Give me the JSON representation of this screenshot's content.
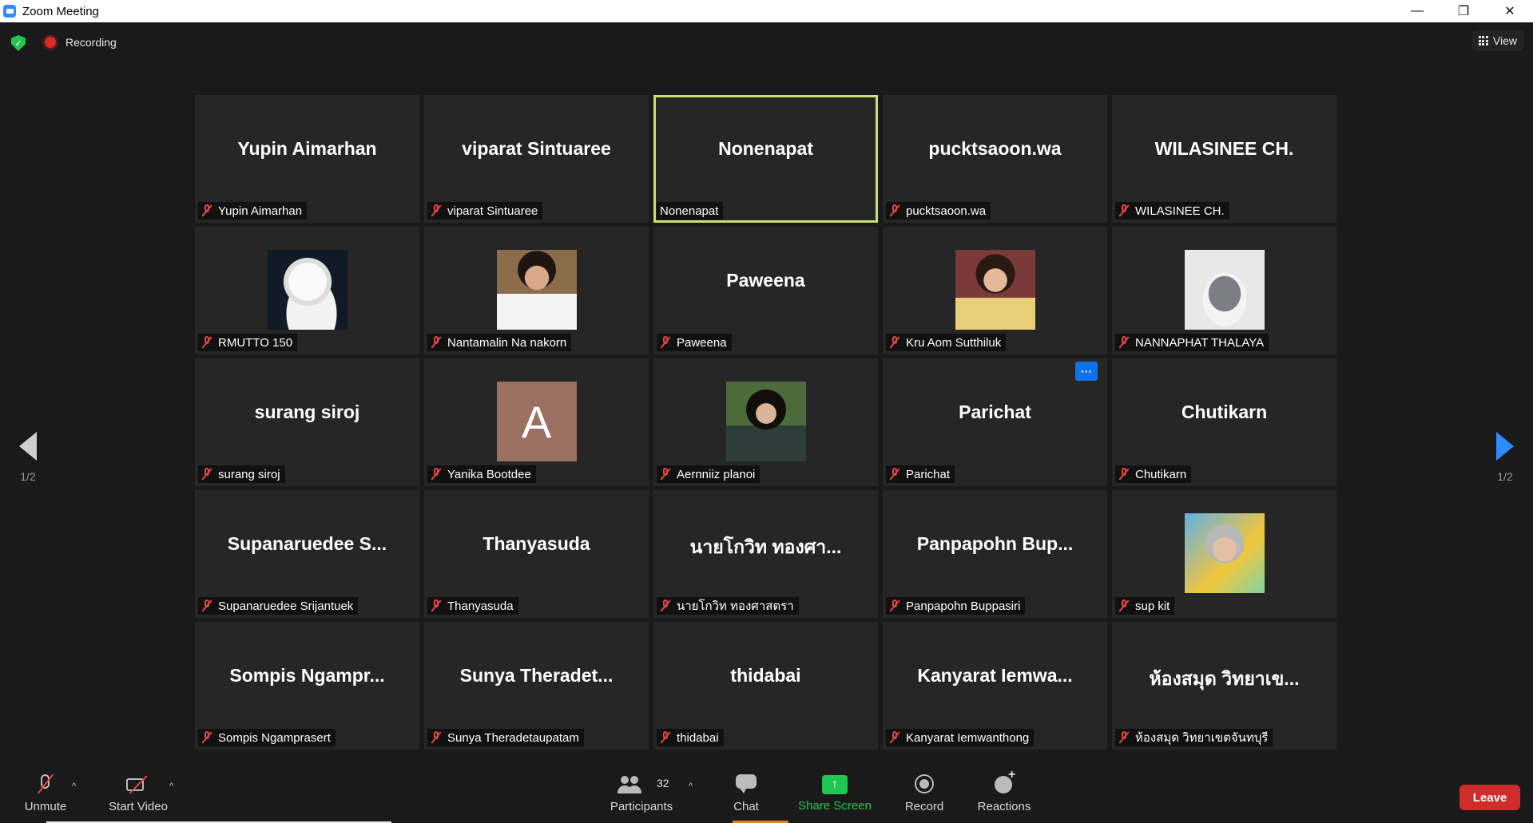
{
  "window": {
    "title": "Zoom Meeting",
    "minimize": "—",
    "restore": "❐",
    "close": "✕"
  },
  "topbar": {
    "recording_label": "Recording",
    "view_label": "View"
  },
  "pagination": {
    "left_label": "1/2",
    "right_label": "1/2"
  },
  "tiles": [
    {
      "display": "Yupin Aimarhan",
      "tag": "Yupin Aimarhan",
      "muted": true
    },
    {
      "display": "viparat Sintuaree",
      "tag": "viparat Sintuaree",
      "muted": true
    },
    {
      "display": "Nonenapat",
      "tag": "Nonenapat",
      "muted": false,
      "active": true
    },
    {
      "display": "pucktsaoon.wa",
      "tag": "pucktsaoon.wa",
      "muted": true
    },
    {
      "display": "WILASINEE CH.",
      "tag": "WILASINEE CH.",
      "muted": true
    },
    {
      "display": "",
      "tag": "RMUTTO 150",
      "muted": true,
      "avatar": "white-cat-photo"
    },
    {
      "display": "",
      "tag": "Nantamalin Na nakorn",
      "muted": true,
      "avatar": "woman-uniform-photo"
    },
    {
      "display": "Paweena",
      "tag": "Paweena",
      "muted": true
    },
    {
      "display": "",
      "tag": "Kru Aom Sutthiluk",
      "muted": true,
      "avatar": "selfie-photo"
    },
    {
      "display": "",
      "tag": "NANNAPHAT THALAYA",
      "muted": true,
      "avatar": "grey-cat-photo"
    },
    {
      "display": "surang siroj",
      "tag": "surang siroj",
      "muted": true
    },
    {
      "display": "",
      "tag": "Yanika Bootdee",
      "muted": true,
      "avatar_letter": "A"
    },
    {
      "display": "",
      "tag": "Aernniiz planoi",
      "muted": true,
      "avatar": "girl-photo"
    },
    {
      "display": "Parichat",
      "tag": "Parichat",
      "muted": true,
      "more": "···"
    },
    {
      "display": "Chutikarn",
      "tag": "Chutikarn",
      "muted": true
    },
    {
      "display": "Supanaruedee S...",
      "tag": "Supanaruedee Srijantuek",
      "muted": true
    },
    {
      "display": "Thanyasuda",
      "tag": "Thanyasuda",
      "muted": true
    },
    {
      "display": "นายโกวิท ทองศา...",
      "tag": "นายโกวิท ทองศาสตรา",
      "muted": true
    },
    {
      "display": "Panpapohn Bup...",
      "tag": "Panpapohn Buppasiri",
      "muted": true
    },
    {
      "display": "",
      "tag": "sup kit",
      "muted": true,
      "avatar": "elder-woman-photo"
    },
    {
      "display": "Sompis Ngampr...",
      "tag": "Sompis Ngamprasert",
      "muted": true
    },
    {
      "display": "Sunya Theradet...",
      "tag": "Sunya Theradetaupatam",
      "muted": true
    },
    {
      "display": "thidabai",
      "tag": "thidabai",
      "muted": true
    },
    {
      "display": "Kanyarat Iemwa...",
      "tag": "Kanyarat Iemwanthong",
      "muted": true
    },
    {
      "display": "ห้องสมุด วิทยาเข...",
      "tag": "ห้องสมุด วิทยาเขตจันทบุรี",
      "muted": true
    }
  ],
  "toolbar": {
    "unmute": "Unmute",
    "start_video": "Start Video",
    "participants": "Participants",
    "participants_count": "32",
    "chat": "Chat",
    "share_screen": "Share Screen",
    "record": "Record",
    "reactions": "Reactions",
    "leave": "Leave",
    "caret": "^"
  },
  "colors": {
    "active_speaker": "#c8e26a",
    "share_green": "#23c552",
    "leave_red": "#d22b2b",
    "accent_blue": "#2d8cff"
  }
}
